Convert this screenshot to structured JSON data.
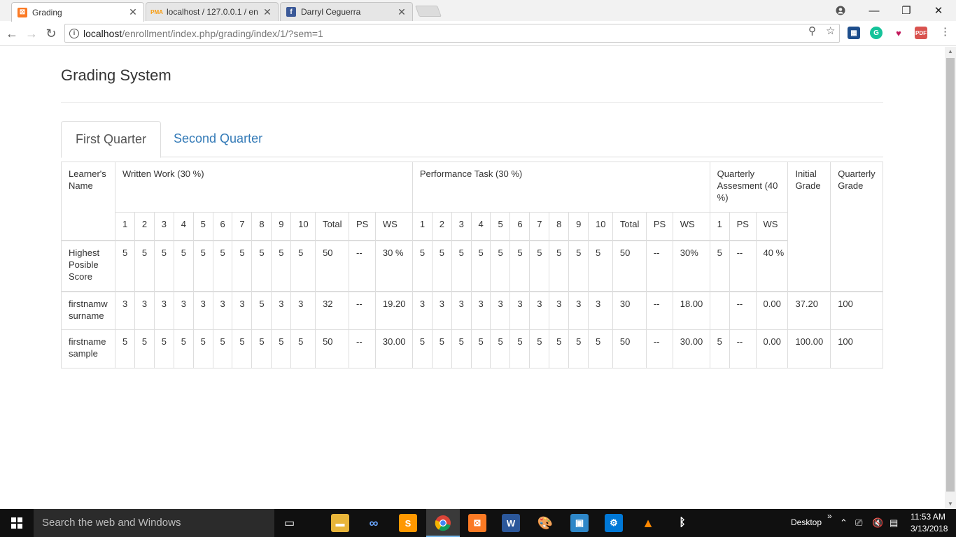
{
  "browser": {
    "tabs": [
      {
        "title": "Grading",
        "icon": "xampp-icon",
        "color": "#fb7a24"
      },
      {
        "title": "localhost / 127.0.0.1 / en",
        "icon": "phpmyadmin-icon",
        "color": "#f89c0e"
      },
      {
        "title": "Darryl Ceguerra",
        "icon": "facebook-icon",
        "color": "#3b5998"
      }
    ],
    "url_host": "localhost",
    "url_path": "/enrollment/index.php/grading/index/1/?sem=1"
  },
  "page": {
    "title": "Grading System",
    "tabs": [
      "First Quarter",
      "Second Quarter"
    ],
    "link_color": "#337ab7"
  },
  "table": {
    "headers": {
      "learner_name": "Learner's Name",
      "written_work": "Written Work (30 %)",
      "performance_task": "Performance Task (30 %)",
      "quarterly_assessment": "Quarterly Assesment (40 %)",
      "initial_grade": "Initial Grade",
      "quarterly_grade": "Quarterly Grade"
    },
    "ww_sub": [
      "1",
      "2",
      "3",
      "4",
      "5",
      "6",
      "7",
      "8",
      "9",
      "10",
      "Total",
      "PS",
      "WS"
    ],
    "pt_sub": [
      "1",
      "2",
      "3",
      "4",
      "5",
      "6",
      "7",
      "8",
      "9",
      "10",
      "Total",
      "PS",
      "WS"
    ],
    "qa_sub": [
      "1",
      "PS",
      "WS"
    ],
    "rows": [
      {
        "name": "Highest Posible Score",
        "ww": [
          "5",
          "5",
          "5",
          "5",
          "5",
          "5",
          "5",
          "5",
          "5",
          "5",
          "50",
          "--",
          "30 %"
        ],
        "pt": [
          "5",
          "5",
          "5",
          "5",
          "5",
          "5",
          "5",
          "5",
          "5",
          "5",
          "50",
          "--",
          "30%"
        ],
        "qa": [
          "5",
          "--",
          "40 %"
        ],
        "initial": "",
        "quarterly": ""
      },
      {
        "name": "firstnamw surname",
        "ww": [
          "3",
          "3",
          "3",
          "3",
          "3",
          "3",
          "3",
          "5",
          "3",
          "3",
          "32",
          "--",
          "19.20"
        ],
        "pt": [
          "3",
          "3",
          "3",
          "3",
          "3",
          "3",
          "3",
          "3",
          "3",
          "3",
          "30",
          "--",
          "18.00"
        ],
        "qa": [
          "",
          "--",
          "0.00"
        ],
        "initial": "37.20",
        "quarterly": "100"
      },
      {
        "name": "firstname sample",
        "ww": [
          "5",
          "5",
          "5",
          "5",
          "5",
          "5",
          "5",
          "5",
          "5",
          "5",
          "50",
          "--",
          "30.00"
        ],
        "pt": [
          "5",
          "5",
          "5",
          "5",
          "5",
          "5",
          "5",
          "5",
          "5",
          "5",
          "50",
          "--",
          "30.00"
        ],
        "qa": [
          "5",
          "--",
          "0.00"
        ],
        "initial": "100.00",
        "quarterly": "100"
      }
    ]
  },
  "taskbar": {
    "search_placeholder": "Search the web and Windows",
    "desktop_label": "Desktop",
    "time": "11:53 AM",
    "date": "3/13/2018",
    "more_label": "»"
  }
}
